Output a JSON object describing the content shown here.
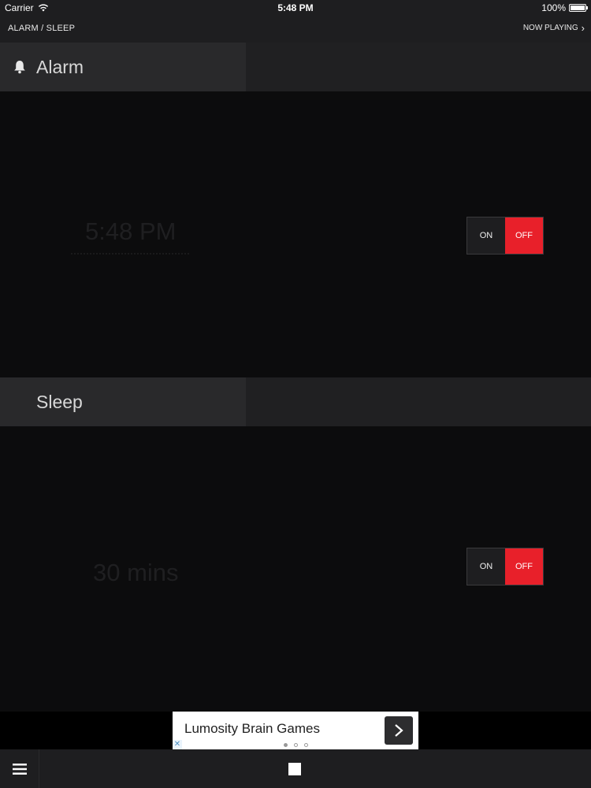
{
  "status_bar": {
    "carrier": "Carrier",
    "time": "5:48 PM",
    "battery": "100%"
  },
  "nav": {
    "title": "ALARM / SLEEP",
    "now_playing": "NOW PLAYING"
  },
  "alarm": {
    "label": "Alarm",
    "time": "5:48 PM",
    "toggle_on": "ON",
    "toggle_off": "OFF",
    "state": "off"
  },
  "sleep": {
    "label": "Sleep",
    "duration": "30 mins",
    "toggle_on": "ON",
    "toggle_off": "OFF",
    "state": "off"
  },
  "ad": {
    "text": "Lumosity Brain Games",
    "page_count": 3,
    "active_page": 1
  },
  "colors": {
    "accent_red": "#e8202a",
    "panel_bg": "#0c0c0d",
    "header_bg": "#29292b"
  }
}
